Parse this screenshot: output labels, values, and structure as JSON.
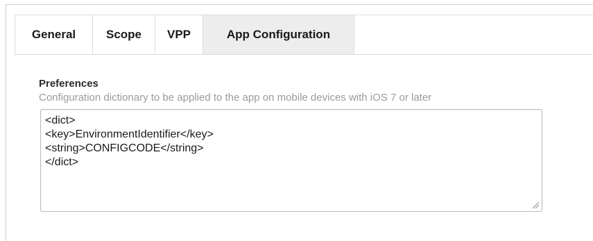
{
  "tabs": [
    {
      "label": "General",
      "active": false
    },
    {
      "label": "Scope",
      "active": false
    },
    {
      "label": "VPP",
      "active": false
    },
    {
      "label": "App Configuration",
      "active": true
    }
  ],
  "preferences": {
    "title": "Preferences",
    "description": "Configuration dictionary to be applied to the app on mobile devices with iOS 7 or later",
    "value": "<dict>\n<key>EnvironmentIdentifier</key>\n<string>CONFIGCODE</string>\n</dict>"
  },
  "icons": {
    "resize_grip": "resize-grip-icon"
  },
  "colors": {
    "active_tab_bg": "#ededed",
    "border": "#dcdcdc",
    "muted_text": "#9a9a9a"
  }
}
